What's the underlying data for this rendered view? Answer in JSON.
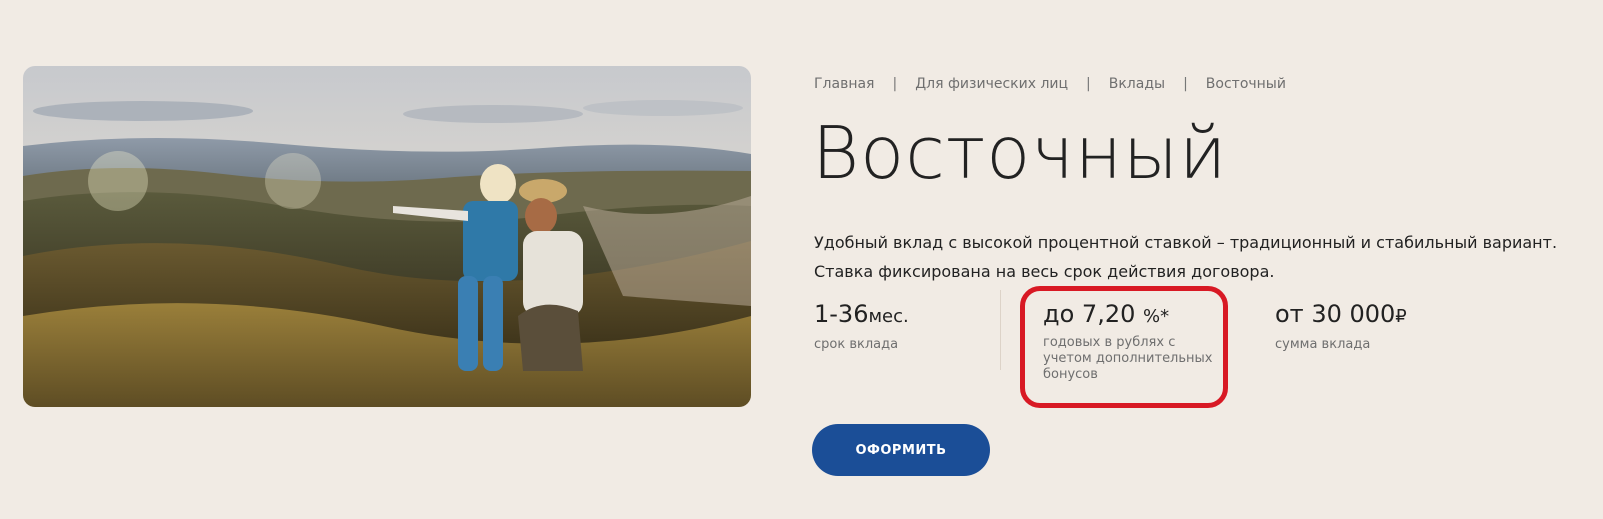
{
  "breadcrumb": {
    "items": [
      "Главная",
      "Для физических лиц",
      "Вклады",
      "Восточный"
    ],
    "separator": "|"
  },
  "title": "Восточный",
  "description": "Удобный вклад с высокой процентной ставкой – традиционный и стабильный вариант. Ставка фиксирована на весь срок действия договора.",
  "stats": {
    "term": {
      "value": "1-36",
      "unit": "мес.",
      "caption": "срок вклада"
    },
    "rate": {
      "prefix": "до",
      "value": "7,20",
      "unit": "%*",
      "caption": "годовых в рублях с учетом дополнительных бонусов"
    },
    "amount": {
      "prefix": "от",
      "value": "30 000",
      "unit": "₽",
      "caption": "сумма вклада"
    }
  },
  "apply_button": {
    "label": "ОФОРМИТЬ"
  },
  "colors": {
    "background": "#f1ebe4",
    "accent": "#1b4e97",
    "highlight": "#d81924"
  },
  "hero_image": {
    "subject": "hero-photo"
  }
}
